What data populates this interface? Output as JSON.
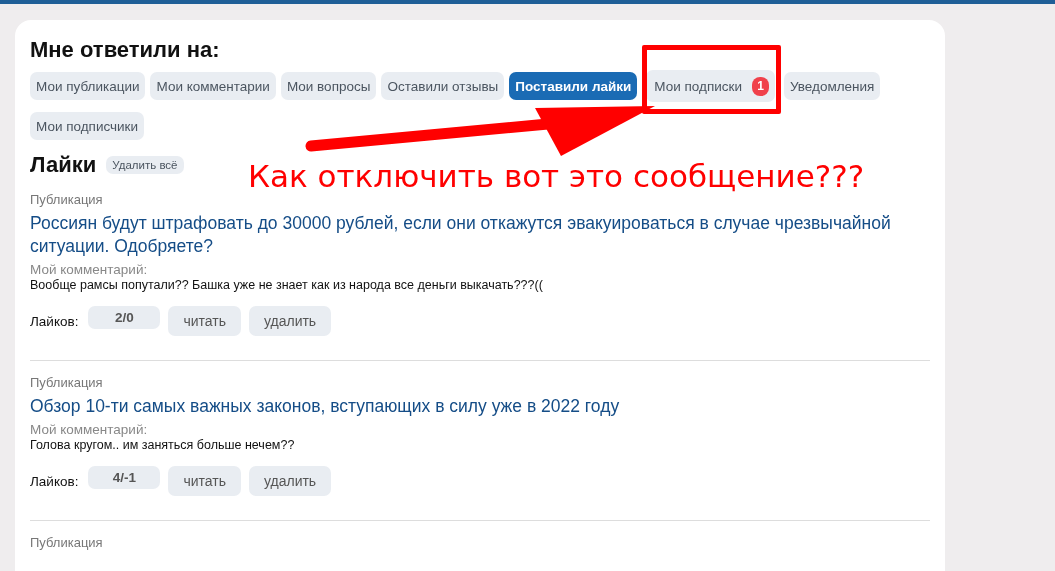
{
  "heading": "Мне ответили на:",
  "tabs": [
    {
      "label": "Мои публикации",
      "selected": false,
      "highlighted": false
    },
    {
      "label": "Мои комментарии",
      "selected": false,
      "highlighted": false
    },
    {
      "label": "Мои вопросы",
      "selected": false,
      "highlighted": false
    },
    {
      "label": "Оставили отзывы",
      "selected": false,
      "highlighted": false
    },
    {
      "label": "Поставили лайки",
      "selected": true,
      "highlighted": false
    },
    {
      "label": "Мои подписки",
      "selected": false,
      "highlighted": true,
      "badge": "1"
    },
    {
      "label": "Уведомления",
      "selected": false,
      "highlighted": false
    },
    {
      "label": "Мои подписчики",
      "selected": false,
      "highlighted": false
    }
  ],
  "section": {
    "title": "Лайки",
    "clear_button": "Удалить всё"
  },
  "annotation": {
    "text": "Как отключить вот это сообщение???"
  },
  "items": [
    {
      "type": "Публикация",
      "title": "Россиян будут штрафовать до 30000 рублей, если они откажутся эвакуироваться в случае чрезвычайной ситуации. Одобряете?",
      "comment_label": "Мой комментарий:",
      "comment": "Вообще рамсы попутали?? Башка уже не знает как из народа все деньги выкачать???((",
      "likes_label": "Лайков:",
      "likes": "2/0",
      "buttons": [
        "читать",
        "удалить"
      ]
    },
    {
      "type": "Публикация",
      "title": "Обзор 10-ти самых важных законов, вступающих в силу уже в 2022 году",
      "comment_label": "Мой комментарий:",
      "comment": "Голова кругом.. им заняться больше нечем??",
      "likes_label": "Лайков:",
      "likes": "4/-1",
      "buttons": [
        "читать",
        "удалить"
      ]
    },
    {
      "type": "Публикация"
    }
  ]
}
